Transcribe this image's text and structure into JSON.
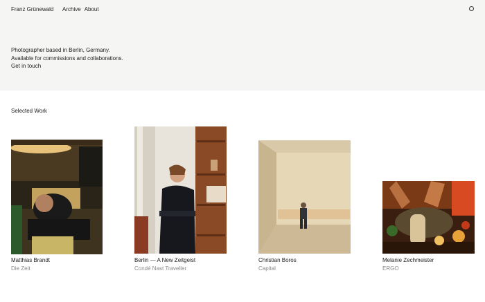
{
  "header": {
    "site_name": "Franz Grünewald",
    "nav": [
      "Archive",
      "About"
    ]
  },
  "intro": {
    "line1": "Photographer based in Berlin, Germany.",
    "line2": "Available for commissions and collaborations.",
    "contact": "Get in touch"
  },
  "section": {
    "title": "Selected Work"
  },
  "works": [
    {
      "name": "Matthias Brandt",
      "publication": "Die Zeit"
    },
    {
      "name": "Berlin — A New Zeitgeist",
      "publication": "Condé Nast Traveller"
    },
    {
      "name": "Christian Boros",
      "publication": "Capital"
    },
    {
      "name": "Melanie Zechmeister",
      "publication": "ERGO"
    }
  ],
  "colors": {
    "top_background": "#f5f5f3",
    "muted_text": "#8a8a8a"
  }
}
